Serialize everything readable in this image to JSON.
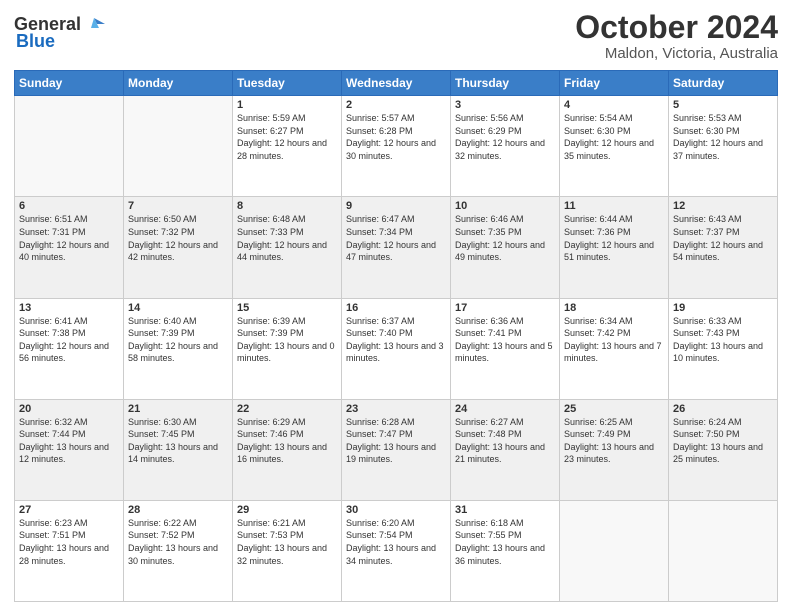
{
  "header": {
    "logo_general": "General",
    "logo_blue": "Blue",
    "month": "October 2024",
    "location": "Maldon, Victoria, Australia"
  },
  "weekdays": [
    "Sunday",
    "Monday",
    "Tuesday",
    "Wednesday",
    "Thursday",
    "Friday",
    "Saturday"
  ],
  "weeks": [
    [
      {
        "day": "",
        "sunrise": "",
        "sunset": "",
        "daylight": "",
        "empty": true
      },
      {
        "day": "",
        "sunrise": "",
        "sunset": "",
        "daylight": "",
        "empty": true
      },
      {
        "day": "1",
        "sunrise": "Sunrise: 5:59 AM",
        "sunset": "Sunset: 6:27 PM",
        "daylight": "Daylight: 12 hours and 28 minutes."
      },
      {
        "day": "2",
        "sunrise": "Sunrise: 5:57 AM",
        "sunset": "Sunset: 6:28 PM",
        "daylight": "Daylight: 12 hours and 30 minutes."
      },
      {
        "day": "3",
        "sunrise": "Sunrise: 5:56 AM",
        "sunset": "Sunset: 6:29 PM",
        "daylight": "Daylight: 12 hours and 32 minutes."
      },
      {
        "day": "4",
        "sunrise": "Sunrise: 5:54 AM",
        "sunset": "Sunset: 6:30 PM",
        "daylight": "Daylight: 12 hours and 35 minutes."
      },
      {
        "day": "5",
        "sunrise": "Sunrise: 5:53 AM",
        "sunset": "Sunset: 6:30 PM",
        "daylight": "Daylight: 12 hours and 37 minutes."
      }
    ],
    [
      {
        "day": "6",
        "sunrise": "Sunrise: 6:51 AM",
        "sunset": "Sunset: 7:31 PM",
        "daylight": "Daylight: 12 hours and 40 minutes."
      },
      {
        "day": "7",
        "sunrise": "Sunrise: 6:50 AM",
        "sunset": "Sunset: 7:32 PM",
        "daylight": "Daylight: 12 hours and 42 minutes."
      },
      {
        "day": "8",
        "sunrise": "Sunrise: 6:48 AM",
        "sunset": "Sunset: 7:33 PM",
        "daylight": "Daylight: 12 hours and 44 minutes."
      },
      {
        "day": "9",
        "sunrise": "Sunrise: 6:47 AM",
        "sunset": "Sunset: 7:34 PM",
        "daylight": "Daylight: 12 hours and 47 minutes."
      },
      {
        "day": "10",
        "sunrise": "Sunrise: 6:46 AM",
        "sunset": "Sunset: 7:35 PM",
        "daylight": "Daylight: 12 hours and 49 minutes."
      },
      {
        "day": "11",
        "sunrise": "Sunrise: 6:44 AM",
        "sunset": "Sunset: 7:36 PM",
        "daylight": "Daylight: 12 hours and 51 minutes."
      },
      {
        "day": "12",
        "sunrise": "Sunrise: 6:43 AM",
        "sunset": "Sunset: 7:37 PM",
        "daylight": "Daylight: 12 hours and 54 minutes."
      }
    ],
    [
      {
        "day": "13",
        "sunrise": "Sunrise: 6:41 AM",
        "sunset": "Sunset: 7:38 PM",
        "daylight": "Daylight: 12 hours and 56 minutes."
      },
      {
        "day": "14",
        "sunrise": "Sunrise: 6:40 AM",
        "sunset": "Sunset: 7:39 PM",
        "daylight": "Daylight: 12 hours and 58 minutes."
      },
      {
        "day": "15",
        "sunrise": "Sunrise: 6:39 AM",
        "sunset": "Sunset: 7:39 PM",
        "daylight": "Daylight: 13 hours and 0 minutes."
      },
      {
        "day": "16",
        "sunrise": "Sunrise: 6:37 AM",
        "sunset": "Sunset: 7:40 PM",
        "daylight": "Daylight: 13 hours and 3 minutes."
      },
      {
        "day": "17",
        "sunrise": "Sunrise: 6:36 AM",
        "sunset": "Sunset: 7:41 PM",
        "daylight": "Daylight: 13 hours and 5 minutes."
      },
      {
        "day": "18",
        "sunrise": "Sunrise: 6:34 AM",
        "sunset": "Sunset: 7:42 PM",
        "daylight": "Daylight: 13 hours and 7 minutes."
      },
      {
        "day": "19",
        "sunrise": "Sunrise: 6:33 AM",
        "sunset": "Sunset: 7:43 PM",
        "daylight": "Daylight: 13 hours and 10 minutes."
      }
    ],
    [
      {
        "day": "20",
        "sunrise": "Sunrise: 6:32 AM",
        "sunset": "Sunset: 7:44 PM",
        "daylight": "Daylight: 13 hours and 12 minutes."
      },
      {
        "day": "21",
        "sunrise": "Sunrise: 6:30 AM",
        "sunset": "Sunset: 7:45 PM",
        "daylight": "Daylight: 13 hours and 14 minutes."
      },
      {
        "day": "22",
        "sunrise": "Sunrise: 6:29 AM",
        "sunset": "Sunset: 7:46 PM",
        "daylight": "Daylight: 13 hours and 16 minutes."
      },
      {
        "day": "23",
        "sunrise": "Sunrise: 6:28 AM",
        "sunset": "Sunset: 7:47 PM",
        "daylight": "Daylight: 13 hours and 19 minutes."
      },
      {
        "day": "24",
        "sunrise": "Sunrise: 6:27 AM",
        "sunset": "Sunset: 7:48 PM",
        "daylight": "Daylight: 13 hours and 21 minutes."
      },
      {
        "day": "25",
        "sunrise": "Sunrise: 6:25 AM",
        "sunset": "Sunset: 7:49 PM",
        "daylight": "Daylight: 13 hours and 23 minutes."
      },
      {
        "day": "26",
        "sunrise": "Sunrise: 6:24 AM",
        "sunset": "Sunset: 7:50 PM",
        "daylight": "Daylight: 13 hours and 25 minutes."
      }
    ],
    [
      {
        "day": "27",
        "sunrise": "Sunrise: 6:23 AM",
        "sunset": "Sunset: 7:51 PM",
        "daylight": "Daylight: 13 hours and 28 minutes."
      },
      {
        "day": "28",
        "sunrise": "Sunrise: 6:22 AM",
        "sunset": "Sunset: 7:52 PM",
        "daylight": "Daylight: 13 hours and 30 minutes."
      },
      {
        "day": "29",
        "sunrise": "Sunrise: 6:21 AM",
        "sunset": "Sunset: 7:53 PM",
        "daylight": "Daylight: 13 hours and 32 minutes."
      },
      {
        "day": "30",
        "sunrise": "Sunrise: 6:20 AM",
        "sunset": "Sunset: 7:54 PM",
        "daylight": "Daylight: 13 hours and 34 minutes."
      },
      {
        "day": "31",
        "sunrise": "Sunrise: 6:18 AM",
        "sunset": "Sunset: 7:55 PM",
        "daylight": "Daylight: 13 hours and 36 minutes."
      },
      {
        "day": "",
        "sunrise": "",
        "sunset": "",
        "daylight": "",
        "empty": true
      },
      {
        "day": "",
        "sunrise": "",
        "sunset": "",
        "daylight": "",
        "empty": true
      }
    ]
  ]
}
